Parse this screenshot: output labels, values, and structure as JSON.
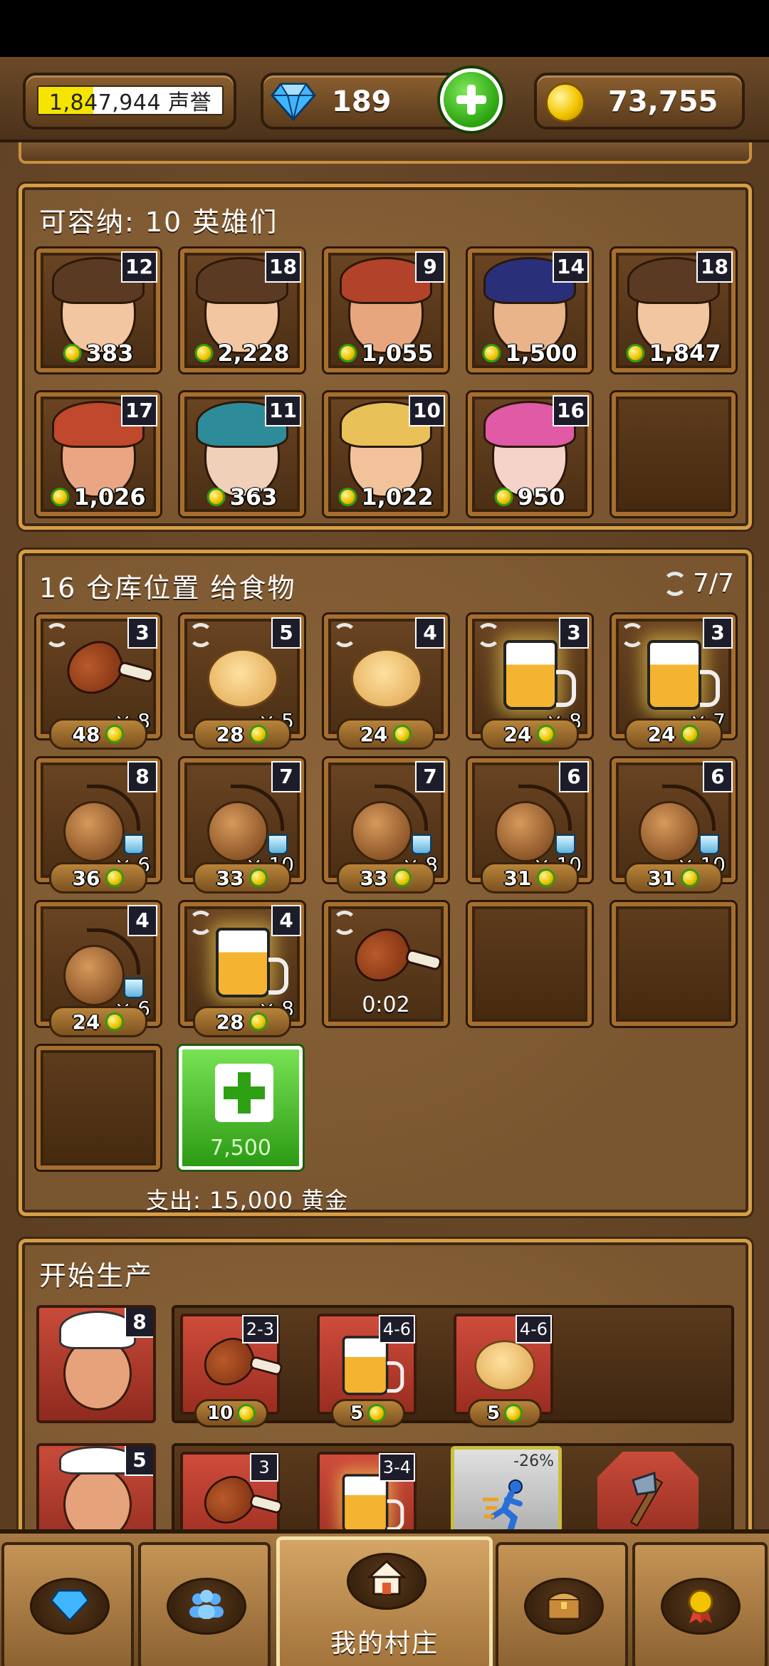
{
  "topbar": {
    "reputation": {
      "text": "1,847,944 声誉",
      "fill_fraction": 0.3
    },
    "gems": "189",
    "gold": "73,755"
  },
  "heroes_panel": {
    "title": "可容纳: 10 英雄们",
    "heroes": [
      {
        "level": "12",
        "cost": "383",
        "hair": "#5a3a22",
        "skin": "#f1c6a0"
      },
      {
        "level": "18",
        "cost": "2,228",
        "hair": "#5a3a22",
        "skin": "#f1c6a0"
      },
      {
        "level": "9",
        "cost": "1,055",
        "hair": "#b2432a",
        "skin": "#e8a67e"
      },
      {
        "level": "14",
        "cost": "1,500",
        "hair": "#2a2f7a",
        "skin": "#e9b48a"
      },
      {
        "level": "18",
        "cost": "1,847",
        "hair": "#5a3a22",
        "skin": "#f1c6a0"
      },
      {
        "level": "17",
        "cost": "1,026",
        "hair": "#c0482c",
        "skin": "#eaa583"
      },
      {
        "level": "11",
        "cost": "363",
        "hair": "#2e8c9a",
        "skin": "#f0d0b8"
      },
      {
        "level": "10",
        "cost": "1,022",
        "hair": "#e8c258",
        "skin": "#f2c39a"
      },
      {
        "level": "16",
        "cost": "950",
        "hair": "#e05aa6",
        "skin": "#f6d3c8"
      }
    ]
  },
  "food_panel": {
    "title": "16 仓库位置 给食物",
    "refresh_count": "7/7",
    "items": [
      {
        "type": "chicken",
        "level": "3",
        "qty": "× 8",
        "price": "48",
        "refresh": true
      },
      {
        "type": "biscuit",
        "level": "5",
        "qty": "× 5",
        "price": "28",
        "refresh": true
      },
      {
        "type": "biscuit",
        "level": "4",
        "qty": "",
        "price": "24",
        "refresh": true
      },
      {
        "type": "beer",
        "level": "3",
        "qty": "× 8",
        "price": "24",
        "refresh": true
      },
      {
        "type": "beer",
        "level": "3",
        "qty": "× 7",
        "price": "24",
        "refresh": true
      },
      {
        "type": "flask",
        "level": "8",
        "qty": "× 6",
        "price": "36",
        "refresh": false
      },
      {
        "type": "flask",
        "level": "7",
        "qty": "× 10",
        "price": "33",
        "refresh": false
      },
      {
        "type": "flask",
        "level": "7",
        "qty": "× 8",
        "price": "33",
        "refresh": false
      },
      {
        "type": "flask",
        "level": "6",
        "qty": "× 10",
        "price": "31",
        "refresh": false
      },
      {
        "type": "flask",
        "level": "6",
        "qty": "× 10",
        "price": "31",
        "refresh": false
      },
      {
        "type": "flask",
        "level": "4",
        "qty": "× 6",
        "price": "24",
        "refresh": false
      },
      {
        "type": "beer",
        "level": "4",
        "qty": "× 8",
        "price": "28",
        "refresh": true
      },
      {
        "type": "chicken",
        "timer": "0:02",
        "refresh": true
      }
    ],
    "add_slot_price": "7,500",
    "expense": "支出: 15,000 黄金"
  },
  "production_panel": {
    "title": "开始生产",
    "rows": [
      {
        "worker_level": "8",
        "products": [
          {
            "type": "chicken",
            "range": "2-3",
            "price": "10"
          },
          {
            "type": "beer",
            "range": "4-6",
            "price": "5"
          },
          {
            "type": "biscuit",
            "range": "4-6",
            "price": "5"
          }
        ]
      },
      {
        "worker_level": "5",
        "products": [
          {
            "type": "chicken",
            "range": "3"
          },
          {
            "type": "beer",
            "range": "3-4"
          }
        ],
        "speed_bonus": "-26%"
      }
    ]
  },
  "bottom_nav": {
    "items": [
      {
        "icon": "gem-icon"
      },
      {
        "icon": "heroes-icon"
      },
      {
        "icon": "house-icon",
        "label": "我的村庄"
      },
      {
        "icon": "chest-icon"
      },
      {
        "icon": "medal-icon"
      }
    ]
  },
  "colors": {
    "panel_border": "#d79d45",
    "gold": "#f2c400",
    "green": "#2aa30e",
    "gem": "#3fb6ff"
  }
}
